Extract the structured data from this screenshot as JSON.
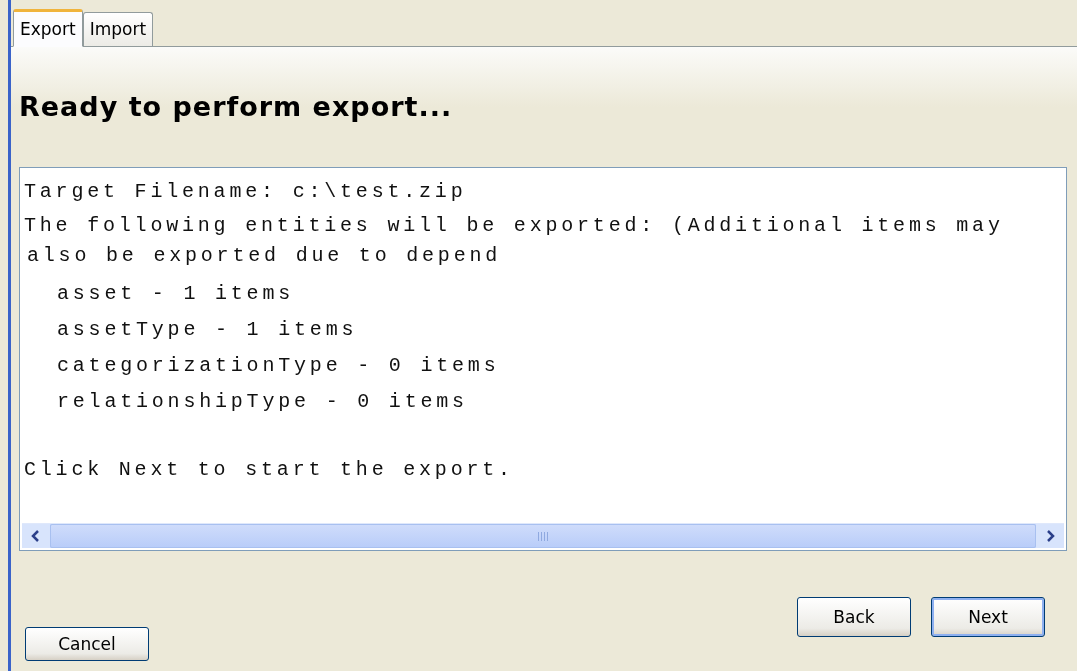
{
  "tabs": [
    {
      "label": "Export",
      "selected": true
    },
    {
      "label": "Import",
      "selected": false
    }
  ],
  "heading": "Ready to perform export...",
  "summary": {
    "target": "Target Filename: c:\\test.zip",
    "intro_lines": [
      "The following entities will be exported: (Additional items may",
      "also be exported due to depend"
    ],
    "entities": [
      "asset - 1 items",
      "assetType - 1 items",
      "categorizationType - 0 items",
      "relationshipType - 0 items"
    ],
    "footer": "Click Next to start the export."
  },
  "buttons": [
    {
      "label": "Cancel",
      "kind": "left",
      "default": false
    },
    {
      "label": "Back",
      "kind": "right",
      "default": false
    },
    {
      "label": "Next",
      "kind": "right",
      "default": true
    }
  ]
}
